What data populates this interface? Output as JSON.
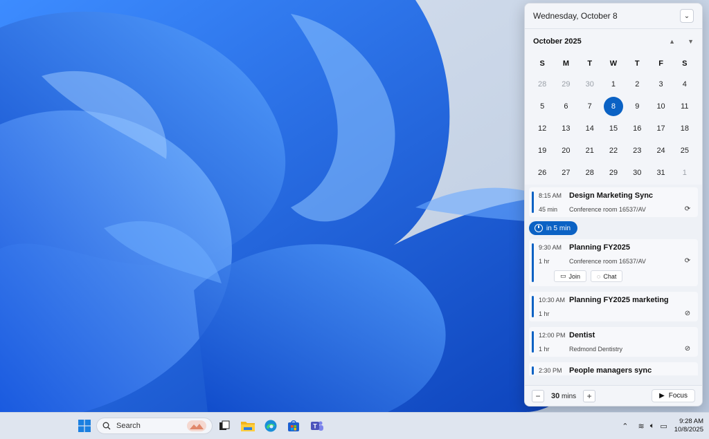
{
  "header": {
    "date": "Wednesday, October 8"
  },
  "calendar": {
    "month": "October 2025",
    "weekdays": [
      "S",
      "M",
      "T",
      "W",
      "T",
      "F",
      "S"
    ],
    "days": [
      {
        "d": "28",
        "m": true
      },
      {
        "d": "29",
        "m": true
      },
      {
        "d": "30",
        "m": true
      },
      {
        "d": "1"
      },
      {
        "d": "2"
      },
      {
        "d": "3"
      },
      {
        "d": "4"
      },
      {
        "d": "5"
      },
      {
        "d": "6"
      },
      {
        "d": "7"
      },
      {
        "d": "8",
        "t": true
      },
      {
        "d": "9"
      },
      {
        "d": "10"
      },
      {
        "d": "11"
      },
      {
        "d": "12"
      },
      {
        "d": "13"
      },
      {
        "d": "14"
      },
      {
        "d": "15"
      },
      {
        "d": "16"
      },
      {
        "d": "17"
      },
      {
        "d": "18"
      },
      {
        "d": "19"
      },
      {
        "d": "20"
      },
      {
        "d": "21"
      },
      {
        "d": "22"
      },
      {
        "d": "23"
      },
      {
        "d": "24"
      },
      {
        "d": "25"
      },
      {
        "d": "26"
      },
      {
        "d": "27"
      },
      {
        "d": "28"
      },
      {
        "d": "29"
      },
      {
        "d": "30"
      },
      {
        "d": "31"
      },
      {
        "d": "1",
        "m": true
      }
    ]
  },
  "agenda": {
    "events": [
      {
        "time": "8:15 AM",
        "title": "Design Marketing Sync",
        "duration": "45 min",
        "location": "Conference room 16537/AV",
        "icon": "recurring-icon"
      },
      {
        "time": "9:30 AM",
        "title": "Planning FY2025",
        "duration": "1 hr",
        "location": "Conference room 16537/AV",
        "icon": "recurring-icon"
      },
      {
        "time": "10:30 AM",
        "title": "Planning FY2025 marketing",
        "duration": "1 hr",
        "location": "",
        "icon": "no-recurring-icon"
      },
      {
        "time": "12:00 PM",
        "title": "Dentist",
        "duration": "1 hr",
        "location": "Redmond Dentistry",
        "icon": "no-recurring-icon"
      },
      {
        "time": "2:30 PM",
        "title": "People managers sync",
        "duration": "",
        "location": "",
        "icon": ""
      }
    ],
    "soon_label": "in 5 min",
    "join_label": "Join",
    "chat_label": "Chat"
  },
  "focus": {
    "minutes": "30",
    "unit": "mins",
    "button_label": "Focus"
  },
  "taskbar": {
    "search_placeholder": "Search",
    "time": "9:28 AM",
    "date": "10/8/2025",
    "accent": "#0b62c4"
  }
}
